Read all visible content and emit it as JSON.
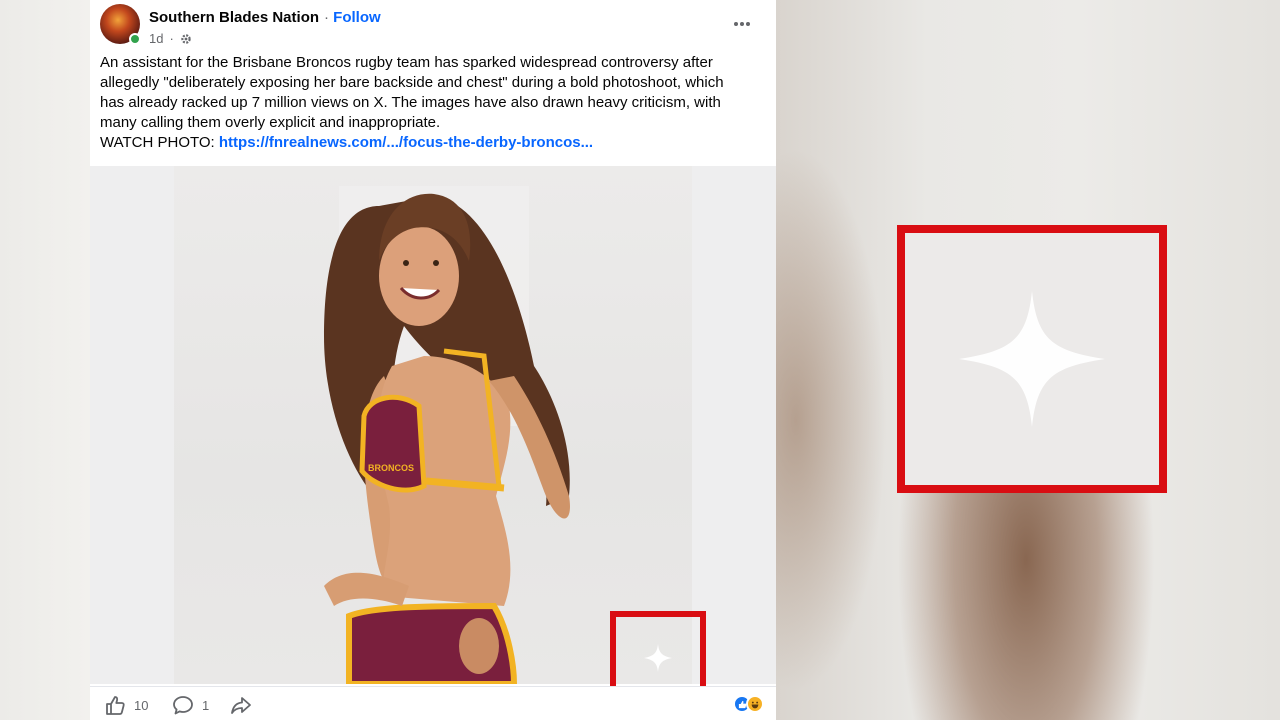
{
  "post": {
    "page_name": "Southern Blades Nation",
    "separator": "·",
    "follow_label": "Follow",
    "time": "1d",
    "text_lines": [
      "An assistant for the Brisbane Broncos rugby team has sparked widespread controversy after",
      "allegedly \"deliberately exposing her bare backside and chest\" during a bold photoshoot, which",
      "has already racked up 7 million views on X. The images have also drawn heavy criticism, with",
      "many calling them overly explicit and inappropriate."
    ],
    "link_prefix": "WATCH PHOTO: ",
    "link_text": "https://fnrealnews.com/.../focus-the-derby-broncos...",
    "photo_logo_text": "BRONCOS"
  },
  "actions": {
    "like_count": "10",
    "comment_count": "1"
  },
  "icons": {
    "avatar": "page-avatar",
    "gear": "audience-gear-icon",
    "more": "more-options-icon",
    "like": "thumbs-up-icon",
    "comment": "comment-bubble-icon",
    "share": "share-arrow-icon",
    "reaction_like": "like-reaction-icon",
    "reaction_haha": "haha-reaction-icon",
    "sparkle": "ai-sparkle-watermark-icon"
  },
  "colors": {
    "highlight_box": "#d90d12",
    "link": "#0866ff",
    "jersey_maroon": "#7a1f3d",
    "jersey_gold": "#f2b323"
  }
}
